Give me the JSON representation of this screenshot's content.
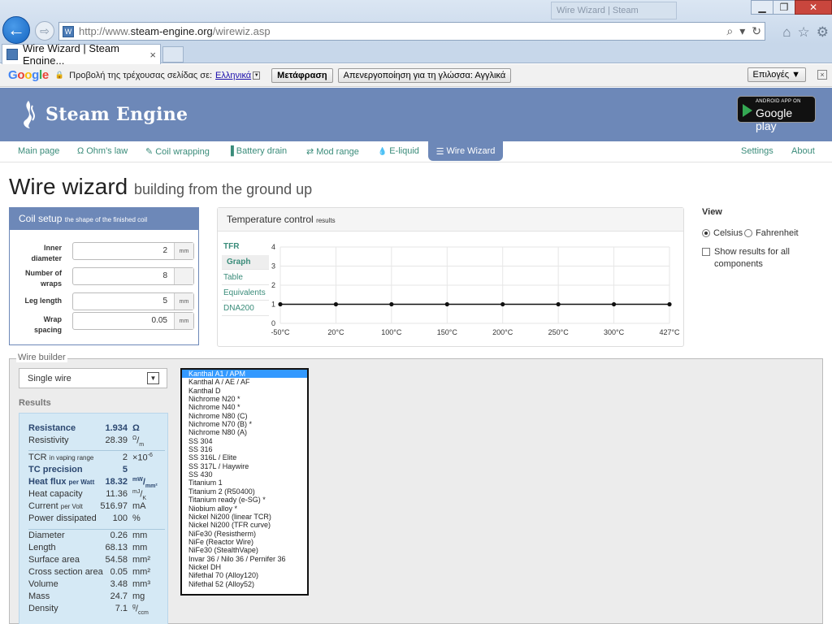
{
  "browser": {
    "url_prefix": "http://www.",
    "url_domain": "steam-engine.org",
    "url_path": "/wirewiz.asp",
    "tab_title": "Wire Wizard | Steam Engine...",
    "tab_close": "×",
    "background_tab_title": "Wire Wizard | Steam",
    "back_glyph": "←",
    "forward_glyph": "⇨"
  },
  "translate_bar": {
    "logo": [
      "G",
      "o",
      "o",
      "g",
      "l",
      "e"
    ],
    "prompt": "Προβολή της τρέχουσας σελίδας σε:",
    "language": "Ελληνικά",
    "translate_button": "Μετάφραση",
    "disable_button": "Απενεργοποίηση για τη γλώσσα: Αγγλικά",
    "options_button": "Επιλογές ▼",
    "close": "×"
  },
  "header": {
    "logo_text": "Steam Engine",
    "gplay_small": "ANDROID APP ON",
    "gplay_big": "Google play"
  },
  "nav": {
    "items": [
      {
        "label": "Main page",
        "icon": ""
      },
      {
        "label": "Ohm's law",
        "icon": "Ω"
      },
      {
        "label": "Coil wrapping",
        "icon": "✎"
      },
      {
        "label": "Battery drain",
        "icon": "▐"
      },
      {
        "label": "Mod range",
        "icon": "⇄"
      },
      {
        "label": "E-liquid",
        "icon": "💧"
      }
    ],
    "active": {
      "label": "Wire Wizard",
      "icon": "☰"
    },
    "settings": "Settings",
    "about": "About"
  },
  "page": {
    "title": "Wire wizard",
    "subtitle": "building from the ground up"
  },
  "coil_setup": {
    "title": "Coil setup",
    "subtitle": "the shape of the finished coil",
    "fields": [
      {
        "label_line1": "Inner",
        "label_line2": "diameter",
        "value": "2",
        "unit": "mm"
      },
      {
        "label_line1": "Number of",
        "label_line2": "wraps",
        "value": "8",
        "unit": ""
      },
      {
        "label_line1": "Leg length",
        "label_line2": "",
        "value": "5",
        "unit": "mm"
      },
      {
        "label_line1": "Wrap",
        "label_line2": "spacing",
        "value": "0.05",
        "unit": "mm"
      }
    ]
  },
  "temperature_control": {
    "title": "Temperature control",
    "subtitle": "results",
    "tabs": [
      "TFR",
      "Graph",
      "Table",
      "Equivalents",
      "DNA200"
    ],
    "selected_tab": "Graph"
  },
  "chart_data": {
    "type": "line",
    "x": [
      "-50°C",
      "20°C",
      "100°C",
      "150°C",
      "200°C",
      "250°C",
      "300°C",
      "427°C"
    ],
    "series": [
      {
        "name": "",
        "values": [
          1,
          1,
          1,
          1,
          1,
          1,
          1,
          1
        ]
      }
    ],
    "yticks": [
      "0",
      "1",
      "2",
      "3",
      "4"
    ],
    "ylim": [
      0,
      4
    ],
    "grid": true,
    "line_color": "#111111"
  },
  "view": {
    "title": "View",
    "celsius": "Celsius",
    "fahrenheit": "Fahrenheit",
    "selected": "Celsius",
    "show_all_line1": "Show results for all",
    "show_all_line2": "components",
    "show_all_checked": false
  },
  "wire_builder": {
    "legend": "Wire builder",
    "type_select": "Single wire",
    "results_label": "Results",
    "results": {
      "resistance": {
        "label": "Resistance",
        "value": "1.934",
        "unit": "Ω"
      },
      "resistivity": {
        "label": "Resistivity",
        "value": "28.39",
        "unit_top": "Ω",
        "unit_bottom": "m"
      },
      "tcr": {
        "label": "TCR",
        "label_small": "in vaping range",
        "value": "2",
        "unit": "×10",
        "unit_sup": "-6"
      },
      "tc_precision": {
        "label": "TC precision",
        "value": "5"
      },
      "heat_flux": {
        "label": "Heat flux",
        "label_small": "per Watt",
        "value": "18.32",
        "unit_top": "mW",
        "unit_bottom": "mm²"
      },
      "heat_capacity": {
        "label": "Heat capacity",
        "value": "11.36",
        "unit_top": "mJ",
        "unit_bottom": "K"
      },
      "current": {
        "label": "Current",
        "label_small": "per Volt",
        "value": "516.97",
        "unit": "mA"
      },
      "power": {
        "label": "Power dissipated",
        "value": "100",
        "unit": "%"
      },
      "diameter": {
        "label": "Diameter",
        "value": "0.26",
        "unit": "mm"
      },
      "length": {
        "label": "Length",
        "value": "68.13",
        "unit": "mm"
      },
      "surface_area": {
        "label": "Surface area",
        "value": "54.58",
        "unit": "mm²"
      },
      "cross_section": {
        "label": "Cross section area",
        "value": "0.05",
        "unit": "mm²"
      },
      "volume": {
        "label": "Volume",
        "value": "3.48",
        "unit": "mm³"
      },
      "mass": {
        "label": "Mass",
        "value": "24.7",
        "unit": "mg"
      },
      "density": {
        "label": "Density",
        "value": "7.1",
        "unit_top": "g",
        "unit_bottom": "ccm"
      }
    },
    "materials": [
      "Kanthal A1 / APM",
      "Kanthal A / AE / AF",
      "Kanthal D",
      "Nichrome N20 *",
      "Nichrome N40 *",
      "Nichrome N80 (C)",
      "Nichrome N70 (B) *",
      "Nichrome N80 (A)",
      "SS 304",
      "SS 316",
      "SS 316L / Elite",
      "SS 317L / Haywire",
      "SS 430",
      "Titanium 1",
      "Titanium 2 (R50400)",
      "Titanium ready (e-SG) *",
      "Niobium alloy *",
      "Nickel Ni200 (linear TCR)",
      "Nickel Ni200 (TFR curve)",
      "NiFe30 (Resistherm)",
      "NiFe (Reactor Wire)",
      "NiFe30 (StealthVape)",
      "Invar 36 / Nilo 36 / Pernifer 36",
      "Nickel DH",
      "Nifethal 70 (Alloy120)",
      "Nifethal 52 (Alloy52)"
    ],
    "selected_material_index": 0
  }
}
